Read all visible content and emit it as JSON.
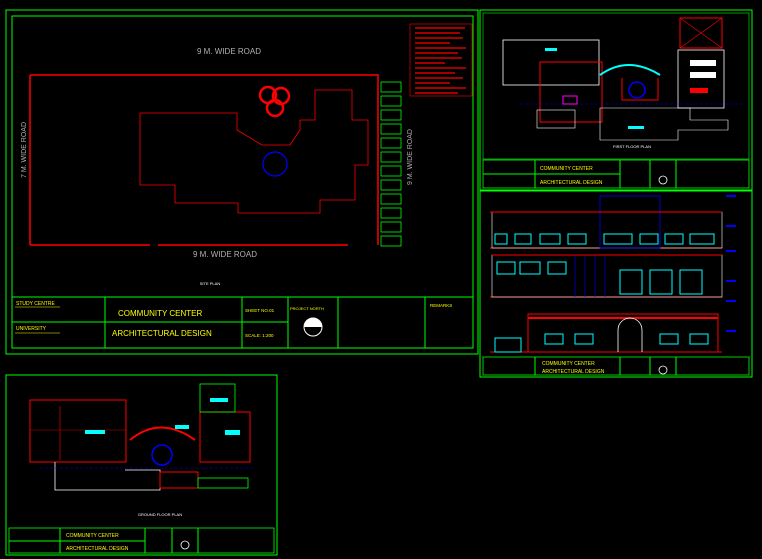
{
  "site_sheet": {
    "road_top": "9 M. WIDE ROAD",
    "road_bottom": "9 M. WIDE ROAD",
    "road_left": "7 M. WIDE ROAD",
    "road_right": "9 M. WIDE ROAD",
    "plan_caption": "SITE PLAN",
    "title_block": {
      "study_centre": "STUDY CENTRE",
      "university": "UNIVERSITY",
      "project": "COMMUNITY CENTER",
      "subject": "ARCHITECTURAL DESIGN",
      "sheet_no": "SHEET NO.01",
      "scale": "SCALE: 1:200",
      "project_north": "PROJECT NORTH",
      "remarks": "REMARKS"
    }
  },
  "first_floor_sheet": {
    "plan_caption": "FIRST FLOOR PLAN",
    "title_block": {
      "project": "COMMUNITY CENTER",
      "subject": "ARCHITECTURAL DESIGN"
    }
  },
  "elevation_sheet": {
    "title_block": {
      "project": "COMMUNITY CENTER",
      "subject": "ARCHITECTURAL DESIGN"
    }
  },
  "ground_floor_sheet": {
    "plan_caption": "GROUND FLOOR PLAN",
    "title_block": {
      "project": "COMMUNITY CENTER",
      "subject": "ARCHITECTURAL DESIGN"
    }
  },
  "colors": {
    "background": "#000000",
    "frame": "#00ff00",
    "wall": "#ff0000",
    "accent": "#00ffff",
    "detail": "#0000ff",
    "text": "#ffffff"
  }
}
